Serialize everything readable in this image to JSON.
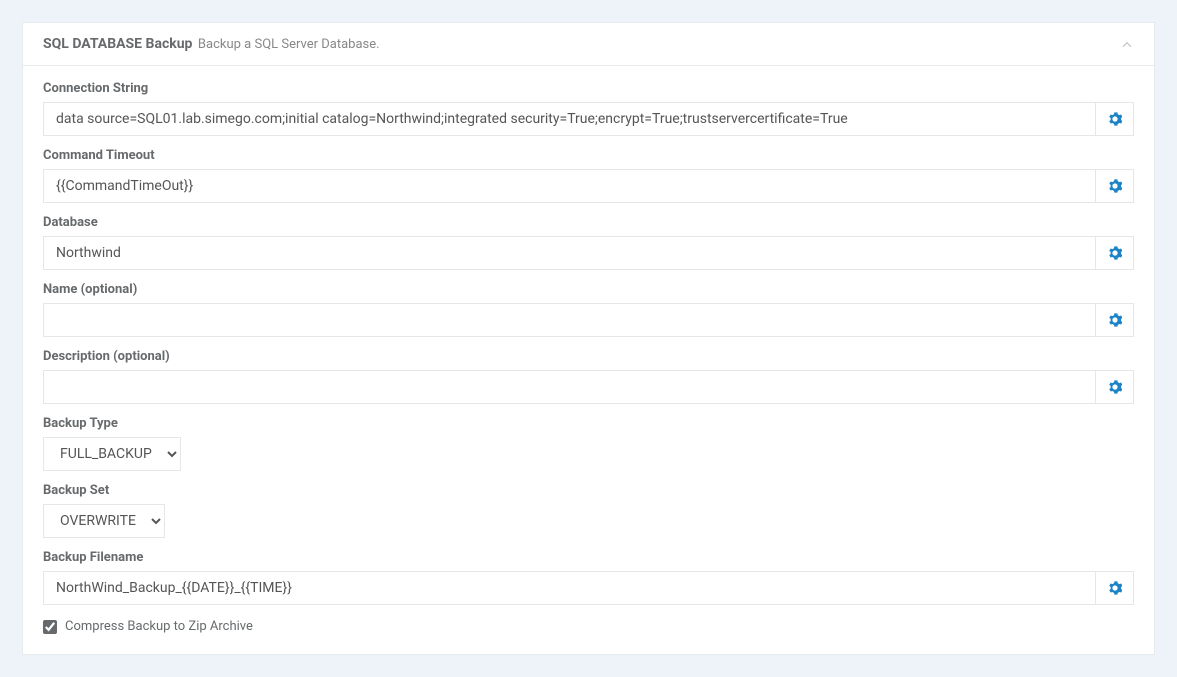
{
  "panel": {
    "title": "SQL DATABASE Backup",
    "subtitle": "Backup a SQL Server Database."
  },
  "fields": {
    "connection_string": {
      "label": "Connection String",
      "value": "data source=SQL01.lab.simego.com;initial catalog=Northwind;integrated security=True;encrypt=True;trustservercertificate=True"
    },
    "command_timeout": {
      "label": "Command Timeout",
      "value": "{{CommandTimeOut}}"
    },
    "database": {
      "label": "Database",
      "value": "Northwind"
    },
    "name": {
      "label": "Name (optional)",
      "value": ""
    },
    "description": {
      "label": "Description (optional)",
      "value": ""
    },
    "backup_type": {
      "label": "Backup Type",
      "value": "FULL_BACKUP"
    },
    "backup_set": {
      "label": "Backup Set",
      "value": "OVERWRITE"
    },
    "backup_filename": {
      "label": "Backup Filename",
      "value": "NorthWind_Backup_{{DATE}}_{{TIME}}"
    },
    "compress": {
      "label": "Compress Backup to Zip Archive",
      "checked": true
    }
  }
}
